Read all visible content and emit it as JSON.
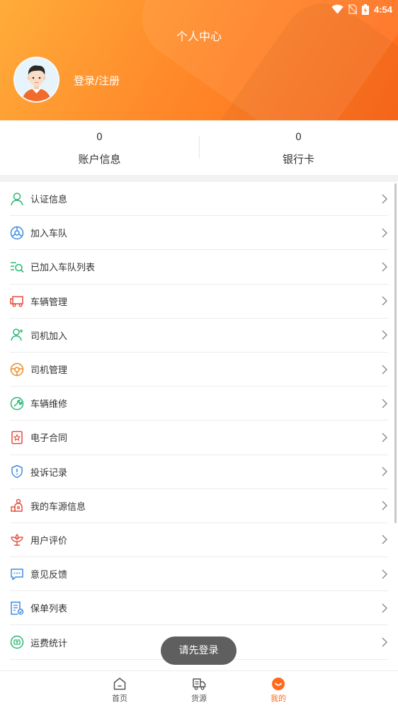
{
  "status_bar": {
    "time": "4:54"
  },
  "header": {
    "title": "个人中心",
    "login_text": "登录/注册"
  },
  "stats": [
    {
      "value": "0",
      "label": "账户信息"
    },
    {
      "value": "0",
      "label": "银行卡"
    }
  ],
  "menu": {
    "items": [
      {
        "label": "认证信息",
        "icon": "user-verify-icon",
        "color": "#2bb673"
      },
      {
        "label": "加入车队",
        "icon": "steering-wheel-icon",
        "color": "#3b8de0"
      },
      {
        "label": "已加入车队列表",
        "icon": "list-search-icon",
        "color": "#2bb673"
      },
      {
        "label": "车辆管理",
        "icon": "truck-icon",
        "color": "#e54b3c"
      },
      {
        "label": "司机加入",
        "icon": "driver-add-icon",
        "color": "#2bb673"
      },
      {
        "label": "司机管理",
        "icon": "steering-wheel-icon",
        "color": "#f08a24"
      },
      {
        "label": "车辆维修",
        "icon": "wrench-icon",
        "color": "#2bb673"
      },
      {
        "label": "电子合同",
        "icon": "contract-icon",
        "color": "#e54b3c"
      },
      {
        "label": "投诉记录",
        "icon": "shield-alert-icon",
        "color": "#3b8de0"
      },
      {
        "label": "我的车源信息",
        "icon": "vehicle-source-icon",
        "color": "#e54b3c"
      },
      {
        "label": "用户评价",
        "icon": "flower-icon",
        "color": "#e54b3c"
      },
      {
        "label": "意见反馈",
        "icon": "chat-bubble-icon",
        "color": "#3b8de0"
      },
      {
        "label": "保单列表",
        "icon": "policy-icon",
        "color": "#3b8de0"
      },
      {
        "label": "运费统计",
        "icon": "freight-stats-icon",
        "color": "#2bb673"
      }
    ]
  },
  "toast": {
    "text": "请先登录"
  },
  "bottom_nav": {
    "items": [
      {
        "label": "首页",
        "icon": "home-icon"
      },
      {
        "label": "货源",
        "icon": "cargo-truck-icon"
      },
      {
        "label": "我的",
        "icon": "mine-icon",
        "active": true
      }
    ]
  },
  "colors": {
    "accent": "#ff6a1c",
    "header_start": "#ffac3a"
  }
}
